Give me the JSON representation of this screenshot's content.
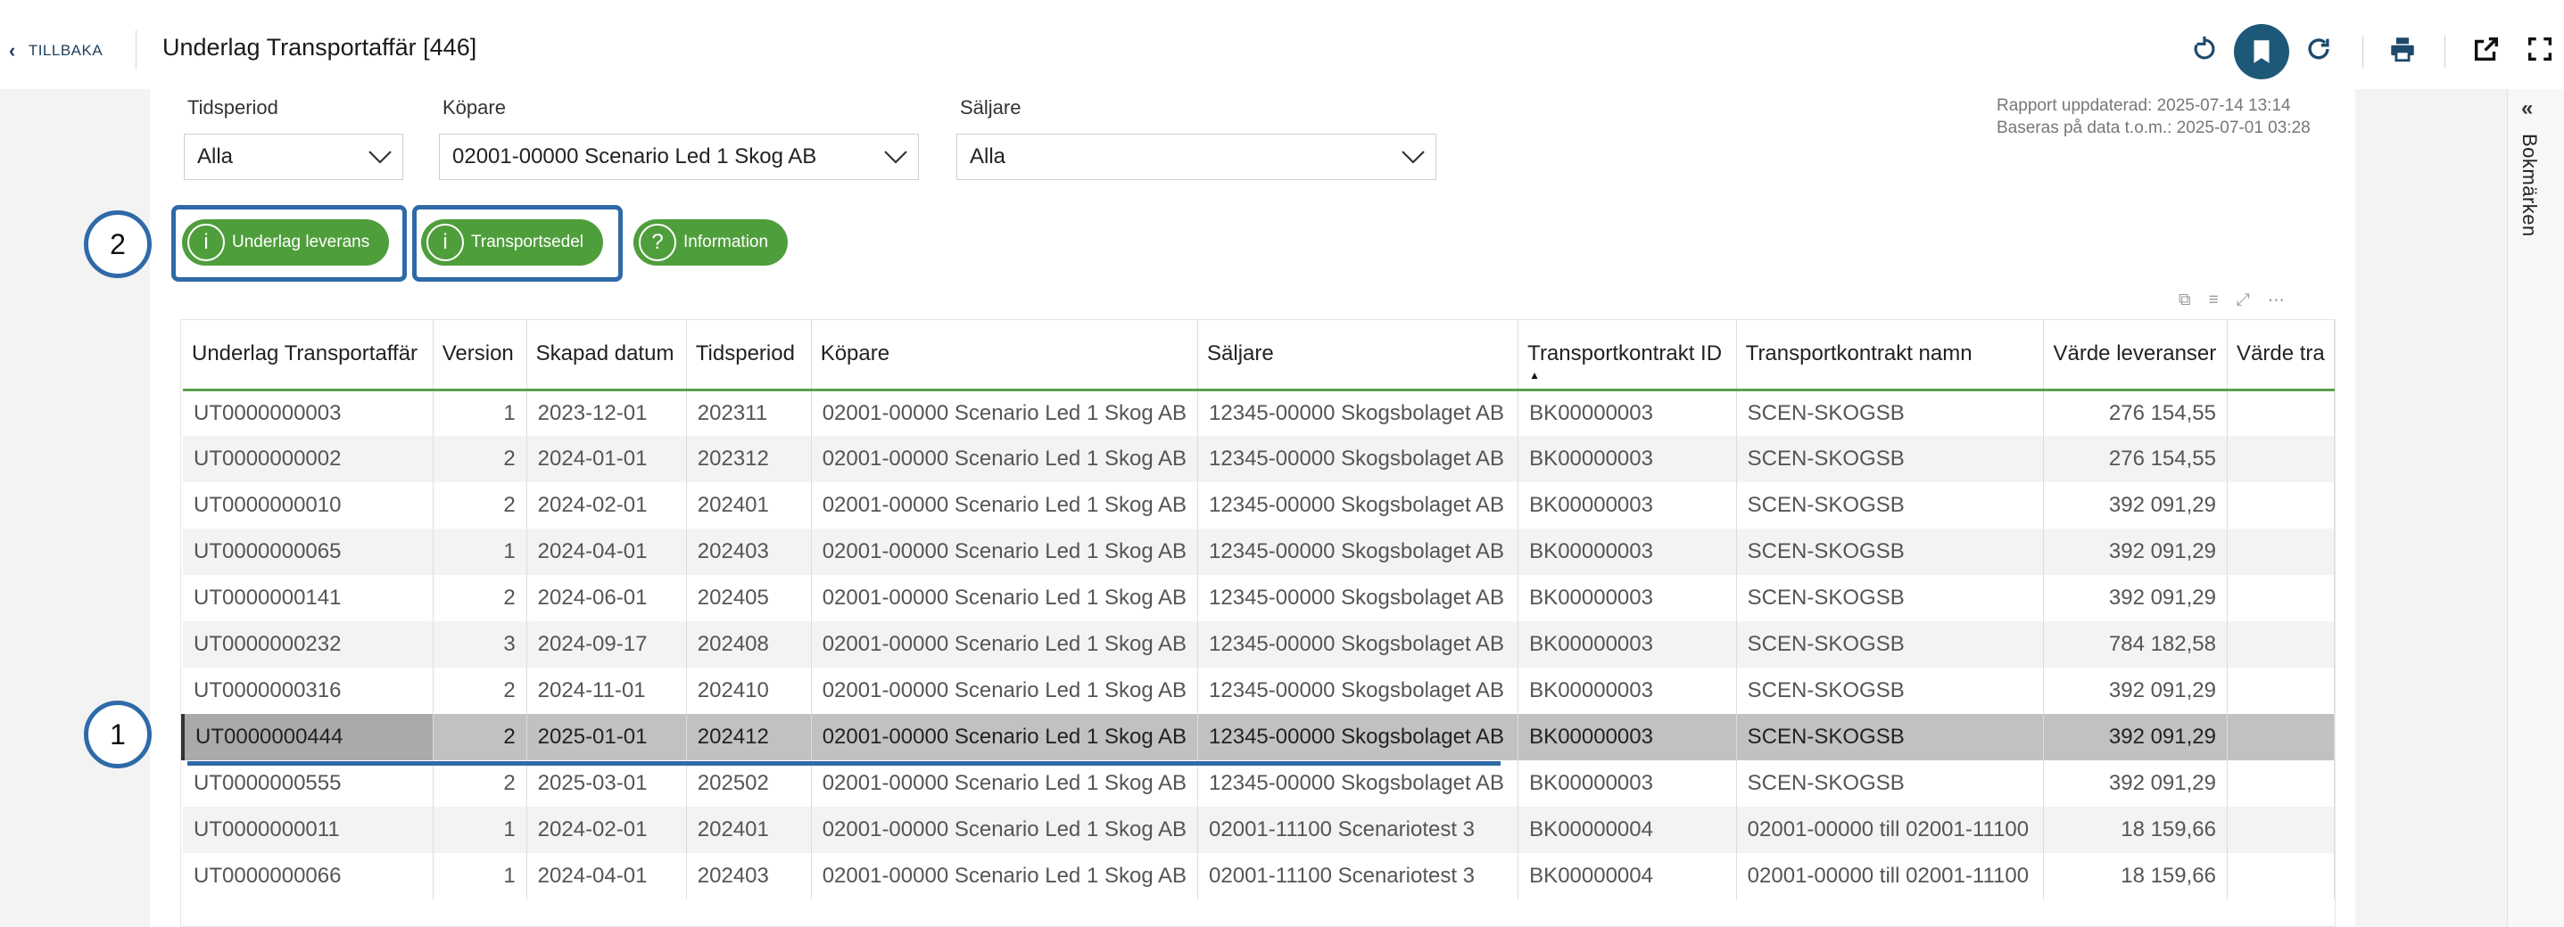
{
  "header": {
    "back_label": "TILLBAKA",
    "title": "Underlag Transportaffär [446]"
  },
  "filters": {
    "period_label": "Tidsperiod",
    "period_value": "Alla",
    "buyer_label": "Köpare",
    "buyer_value": "02001-00000 Scenario Led 1 Skog AB",
    "seller_label": "Säljare",
    "seller_value": "Alla"
  },
  "report_info": {
    "updated": "Rapport uppdaterad: 2025-07-14 13:14",
    "based_on": "Baseras på data t.o.m.: 2025-07-01 03:28"
  },
  "buttons": {
    "underlag_leverans": "Underlag leverans",
    "transportsedel": "Transportsedel",
    "information": "Information",
    "info_glyph": "i",
    "help_glyph": "?"
  },
  "markers": {
    "one": "1",
    "two": "2"
  },
  "bookmarks": {
    "label": "Bokmärken",
    "collapse_glyph": "«"
  },
  "visual_header_icons": [
    "copy-icon",
    "filter-icon",
    "focus-mode-icon",
    "more-options-icon"
  ],
  "table": {
    "columns": [
      "Underlag Transportaffär",
      "Version",
      "Skapad datum",
      "Tidsperiod",
      "Köpare",
      "Säljare",
      "Transportkontrakt ID",
      "Transportkontrakt namn",
      "Värde leveranser",
      "Värde tra"
    ],
    "sort_indicator": "▲",
    "rows": [
      [
        "UT0000000003",
        "1",
        "2023-12-01",
        "202311",
        "02001-00000 Scenario Led 1 Skog AB",
        "12345-00000 Skogsbolaget AB",
        "BK00000003",
        "SCEN-SKOGSB",
        "276 154,55",
        ""
      ],
      [
        "UT0000000002",
        "2",
        "2024-01-01",
        "202312",
        "02001-00000 Scenario Led 1 Skog AB",
        "12345-00000 Skogsbolaget AB",
        "BK00000003",
        "SCEN-SKOGSB",
        "276 154,55",
        ""
      ],
      [
        "UT0000000010",
        "2",
        "2024-02-01",
        "202401",
        "02001-00000 Scenario Led 1 Skog AB",
        "12345-00000 Skogsbolaget AB",
        "BK00000003",
        "SCEN-SKOGSB",
        "392 091,29",
        ""
      ],
      [
        "UT0000000065",
        "1",
        "2024-04-01",
        "202403",
        "02001-00000 Scenario Led 1 Skog AB",
        "12345-00000 Skogsbolaget AB",
        "BK00000003",
        "SCEN-SKOGSB",
        "392 091,29",
        ""
      ],
      [
        "UT0000000141",
        "2",
        "2024-06-01",
        "202405",
        "02001-00000 Scenario Led 1 Skog AB",
        "12345-00000 Skogsbolaget AB",
        "BK00000003",
        "SCEN-SKOGSB",
        "392 091,29",
        ""
      ],
      [
        "UT0000000232",
        "3",
        "2024-09-17",
        "202408",
        "02001-00000 Scenario Led 1 Skog AB",
        "12345-00000 Skogsbolaget AB",
        "BK00000003",
        "SCEN-SKOGSB",
        "784 182,58",
        ""
      ],
      [
        "UT0000000316",
        "2",
        "2024-11-01",
        "202410",
        "02001-00000 Scenario Led 1 Skog AB",
        "12345-00000 Skogsbolaget AB",
        "BK00000003",
        "SCEN-SKOGSB",
        "392 091,29",
        ""
      ],
      [
        "UT0000000444",
        "2",
        "2025-01-01",
        "202412",
        "02001-00000 Scenario Led 1 Skog AB",
        "12345-00000 Skogsbolaget AB",
        "BK00000003",
        "SCEN-SKOGSB",
        "392 091,29",
        ""
      ],
      [
        "UT0000000555",
        "2",
        "2025-03-01",
        "202502",
        "02001-00000 Scenario Led 1 Skog AB",
        "12345-00000 Skogsbolaget AB",
        "BK00000003",
        "SCEN-SKOGSB",
        "392 091,29",
        ""
      ],
      [
        "UT0000000011",
        "1",
        "2024-02-01",
        "202401",
        "02001-00000 Scenario Led 1 Skog AB",
        "02001-11100 Scenariotest 3",
        "BK00000004",
        "02001-00000 till 02001-11100",
        "18 159,66",
        ""
      ],
      [
        "UT0000000066",
        "1",
        "2024-04-01",
        "202403",
        "02001-00000 Scenario Led 1 Skog AB",
        "02001-11100 Scenariotest 3",
        "BK00000004",
        "02001-00000 till 02001-11100",
        "18 159,66",
        ""
      ]
    ],
    "selected_row_index": 7
  },
  "colors": {
    "accent_green": "#4f9e3c",
    "highlight_blue": "#2f6aa8",
    "toolbar_active": "#1e5878"
  }
}
